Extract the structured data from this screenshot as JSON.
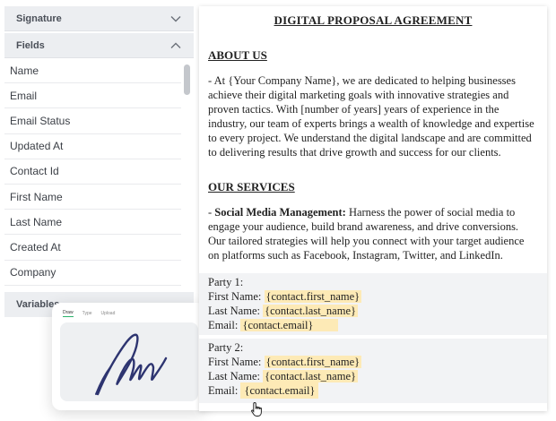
{
  "sidebar": {
    "signature_label": "Signature",
    "fields_label": "Fields",
    "variables_label": "Variables",
    "fields": [
      "Name",
      "Email",
      "Email Status",
      "Updated At",
      "Contact Id",
      "First Name",
      "Last Name",
      "Created At",
      "Company"
    ]
  },
  "signature_pad": {
    "tabs": [
      "Draw",
      "Type",
      "Upload"
    ],
    "active_tab": "Draw"
  },
  "document": {
    "title": "DIGITAL PROPOSAL AGREEMENT",
    "about_title": "ABOUT US",
    "about_text": "- At {Your Company Name}, we are dedicated to helping businesses achieve their digital marketing goals with innovative strategies and proven tactics. With [number of years] years of experience in the industry, our team of experts brings a wealth of knowledge and expertise to every project. We understand the digital landscape and are committed to delivering results that drive growth and success for our clients.",
    "services_title": "OUR SERVICES",
    "services_lead": "Social Media Management:",
    "services_text": " Harness the power of social media to engage your audience, build brand awareness, and drive conversions. Our tailored strategies will help you connect with your target audience on platforms such as Facebook, Instagram, Twitter, and LinkedIn.",
    "party1": {
      "heading": "Party 1:",
      "first_label": "First Name: ",
      "first_token": "{contact.first_name}",
      "last_label": "Last Name: ",
      "last_token": "{contact.last_name}",
      "email_label": "Email: ",
      "email_token": "{contact.email}"
    },
    "party2": {
      "heading": "Party 2:",
      "first_label": "First Name: ",
      "first_token": "{contact.first_name}",
      "last_label": "Last Name: ",
      "last_token": "{contact.last_name}",
      "email_label": "Email:",
      "email_token": "{contact.email}"
    }
  },
  "colors": {
    "token_highlight": "#fdeab6",
    "panel_header": "#eceef1",
    "active_tab_underline": "#2bb36b"
  }
}
